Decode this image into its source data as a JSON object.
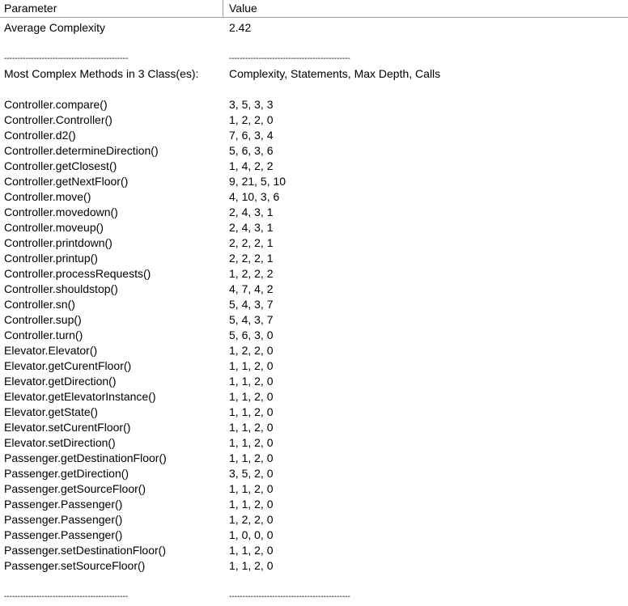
{
  "header": {
    "parameter_label": "Parameter",
    "value_label": "Value"
  },
  "summary": {
    "average_label": "Average Complexity",
    "average_value": "2.42"
  },
  "separator": {
    "left": "----------------------------------------------",
    "right": "---------------------------------------------"
  },
  "methods_header": {
    "label": "Most Complex Methods in 3 Class(es):",
    "columns": "Complexity, Statements, Max Depth, Calls"
  },
  "methods": [
    {
      "name": "Controller.compare()",
      "value": "3, 5, 3, 3"
    },
    {
      "name": "Controller.Controller()",
      "value": "1, 2, 2, 0"
    },
    {
      "name": "Controller.d2()",
      "value": "7, 6, 3, 4"
    },
    {
      "name": "Controller.determineDirection()",
      "value": "5, 6, 3, 6"
    },
    {
      "name": "Controller.getClosest()",
      "value": "1, 4, 2, 2"
    },
    {
      "name": "Controller.getNextFloor()",
      "value": "9, 21, 5, 10"
    },
    {
      "name": "Controller.move()",
      "value": "4, 10, 3, 6"
    },
    {
      "name": "Controller.movedown()",
      "value": "2, 4, 3, 1"
    },
    {
      "name": "Controller.moveup()",
      "value": "2, 4, 3, 1"
    },
    {
      "name": "Controller.printdown()",
      "value": "2, 2, 2, 1"
    },
    {
      "name": "Controller.printup()",
      "value": "2, 2, 2, 1"
    },
    {
      "name": "Controller.processRequests()",
      "value": "1, 2, 2, 2"
    },
    {
      "name": "Controller.shouldstop()",
      "value": "4, 7, 4, 2"
    },
    {
      "name": "Controller.sn()",
      "value": "5, 4, 3, 7"
    },
    {
      "name": "Controller.sup()",
      "value": "5, 4, 3, 7"
    },
    {
      "name": "Controller.turn()",
      "value": "5, 6, 3, 0"
    },
    {
      "name": "Elevator.Elevator()",
      "value": "1, 2, 2, 0"
    },
    {
      "name": "Elevator.getCurentFloor()",
      "value": "1, 1, 2, 0"
    },
    {
      "name": "Elevator.getDirection()",
      "value": "1, 1, 2, 0"
    },
    {
      "name": "Elevator.getElevatorInstance()",
      "value": "1, 1, 2, 0"
    },
    {
      "name": "Elevator.getState()",
      "value": "1, 1, 2, 0"
    },
    {
      "name": "Elevator.setCurentFloor()",
      "value": "1, 1, 2, 0"
    },
    {
      "name": "Elevator.setDirection()",
      "value": "1, 1, 2, 0"
    },
    {
      "name": "Passenger.getDestinationFloor()",
      "value": "1, 1, 2, 0"
    },
    {
      "name": "Passenger.getDirection()",
      "value": "3, 5, 2, 0"
    },
    {
      "name": "Passenger.getSourceFloor()",
      "value": "1, 1, 2, 0"
    },
    {
      "name": "Passenger.Passenger()",
      "value": "1, 1, 2, 0"
    },
    {
      "name": "Passenger.Passenger()",
      "value": "1, 2, 2, 0"
    },
    {
      "name": "Passenger.Passenger()",
      "value": "1, 0, 0, 0"
    },
    {
      "name": "Passenger.setDestinationFloor()",
      "value": "1, 1, 2, 0"
    },
    {
      "name": "Passenger.setSourceFloor()",
      "value": "1, 1, 2, 0"
    }
  ]
}
